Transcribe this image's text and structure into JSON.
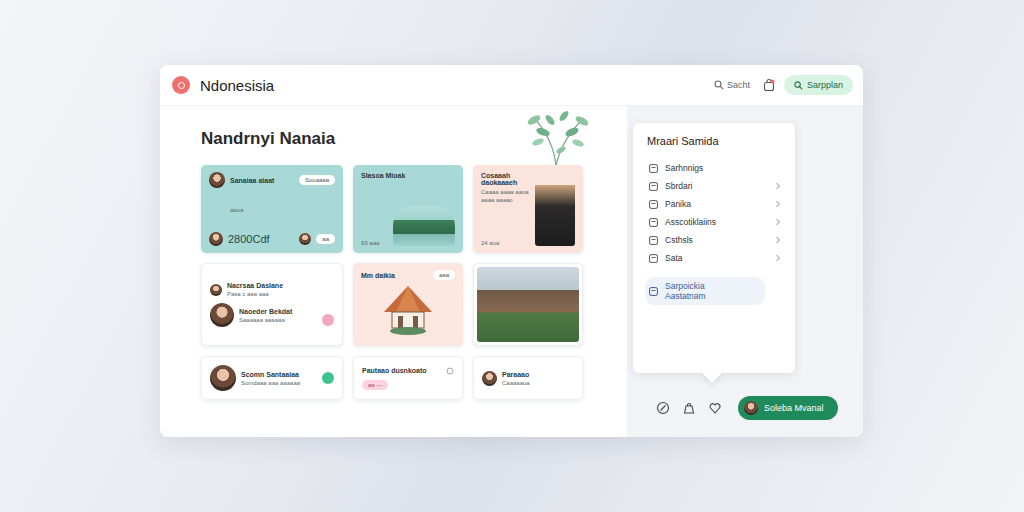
{
  "app": {
    "title": "Ndonesisia"
  },
  "header": {
    "search": "Sacht",
    "button": "Sarpplan"
  },
  "page": {
    "title": "Nandrnyi Nanaia"
  },
  "cards": [
    {
      "kind": "stat",
      "color": "#a8d9d6",
      "title": "Sanaiaa aiaat",
      "subtitle": "aaoa",
      "chip": "Sooaaaa",
      "value": "2800Cdf",
      "tag": "aa"
    },
    {
      "kind": "scene",
      "color": "#a8d9d6",
      "title": "Slasoa Mioak",
      "count": "63 aaa"
    },
    {
      "kind": "feature",
      "color": "#fbe4dc",
      "title": "Cosaaah daokaaaeh",
      "body": "Caaaa aaaa aaoa aaaa aaaao",
      "count": "24 aoa"
    },
    {
      "kind": "people",
      "color": "#ffffff",
      "people": [
        {
          "name": "Nacrsaa Daslane",
          "sub": "Pasa ɔ aaa aaa"
        },
        {
          "name": "Naoeder Bekdat",
          "sub": "Saaaaaa aaaaaa"
        }
      ]
    },
    {
      "kind": "illustration",
      "color": "#fce6e0",
      "title": "Mm daikia",
      "chip": "aaa"
    },
    {
      "kind": "photo",
      "color": "#ffffff"
    },
    {
      "kind": "contact",
      "color": "#ffffff",
      "name": "Scomn Santaaiaa",
      "sub": "Somdaaa aaa aaaaaa",
      "badge": true
    },
    {
      "kind": "chip",
      "color": "#ffffff",
      "title": "Pautaao dusnkoato",
      "chip": "aa ---"
    },
    {
      "kind": "contact",
      "color": "#ffffff",
      "name": "Paraaao",
      "sub": "Caaaaaoa",
      "badge": false
    }
  ],
  "menu": {
    "title": "Mraari Samida",
    "items": [
      {
        "label": "Sarhnnigs",
        "expandable": false,
        "selected": false
      },
      {
        "label": "Sbrdari",
        "expandable": true,
        "selected": false
      },
      {
        "label": "Panika",
        "expandable": true,
        "selected": false
      },
      {
        "label": "Asscotiklaiins",
        "expandable": true,
        "selected": false
      },
      {
        "label": "Csthsls",
        "expandable": true,
        "selected": false
      },
      {
        "label": "Sata",
        "expandable": true,
        "selected": false
      },
      {
        "label": "Sarpoickia Aastatnam",
        "expandable": false,
        "selected": true
      }
    ]
  },
  "footer": {
    "button": "Soleba Mvanal"
  }
}
